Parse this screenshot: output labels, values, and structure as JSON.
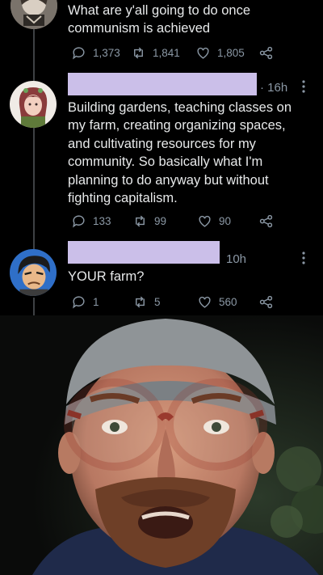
{
  "tweets": [
    {
      "text": "What are y'all going to do once\ncommunism is achieved",
      "reply_count": "1,373",
      "retweet_count": "1,841",
      "like_count": "1,805"
    },
    {
      "time": "· 16h",
      "text": "Building gardens, teaching classes on\nmy farm,  creating organizing spaces,\nand cultivating resources for my\ncommunity. So basically what I'm\nplanning to do anyway but without\nfighting capitalism.",
      "reply_count": "133",
      "retweet_count": "99",
      "like_count": "90"
    },
    {
      "time": "10h",
      "text": "YOUR farm?",
      "reply_count": "1",
      "retweet_count": "5",
      "like_count": "560"
    }
  ],
  "colors": {
    "background": "#000000",
    "text": "#e7e9ea",
    "muted": "#8b98a5",
    "thread_line": "#3e4144",
    "name_redaction": "#cbbfe9"
  },
  "icons": [
    "reply-icon",
    "retweet-icon",
    "like-icon",
    "share-icon",
    "more-icon"
  ]
}
